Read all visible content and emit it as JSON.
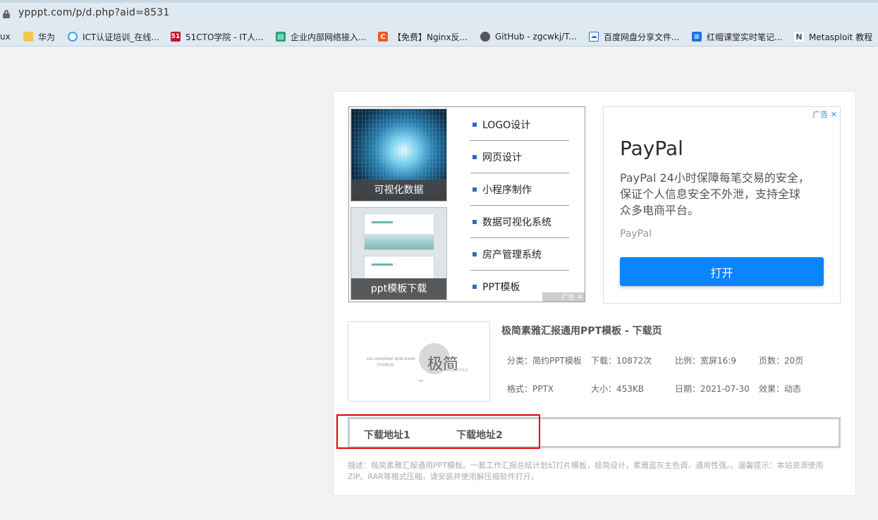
{
  "browser": {
    "url": "ypppt.com/p/d.php?aid=8531",
    "bookmarks": [
      {
        "label": "ux",
        "icon": "none"
      },
      {
        "label": "华为",
        "icon": "folder-icon"
      },
      {
        "label": "ICT认证培训_在线...",
        "icon": "ict-icon"
      },
      {
        "label": "51CTO学院 - IT人...",
        "icon": "51cto-icon"
      },
      {
        "label": "企业内部网络接入...",
        "icon": "doc-icon"
      },
      {
        "label": "【免费】Nginx反...",
        "icon": "csdn-icon"
      },
      {
        "label": "GitHub - zgcwkj/T...",
        "icon": "github-icon"
      },
      {
        "label": "百度网盘分享文件...",
        "icon": "baidu-icon"
      },
      {
        "label": "红帽课堂实时笔记...",
        "icon": "note-icon"
      },
      {
        "label": "Metasploit 教程",
        "icon": "metasploit-icon"
      }
    ],
    "bookmark_icon_glyphs": {
      "51cto": "51",
      "doc": "▤",
      "csdn": "C",
      "baidu": "☁",
      "note": "≡",
      "metasploit": "N"
    }
  },
  "ad_left": {
    "thumb1_caption": "可视化数据",
    "thumb2_caption": "ppt模板下载",
    "items": [
      "LOGO设计",
      "网页设计",
      "小程序制作",
      "数据可视化系统",
      "房产管理系统",
      "PPT模板"
    ],
    "ad_label": "广告",
    "close": "✕"
  },
  "ad_right": {
    "tag": "广告",
    "close": "✕",
    "name": "PayPal",
    "description": "PayPal 24小时保障每笔交易的安全，保证个人信息安全不外泄，支持全球众多电商平台。",
    "source": "PayPal",
    "button": "打开"
  },
  "product": {
    "thumb_big": "极简",
    "thumb_small1": "2021 DEPARTMENT WORK REPORT",
    "thumb_small2": "工作总结汇报",
    "thumb_small3": "MAL STYLE",
    "title": "极简素雅汇报通用PPT模板 - 下载页",
    "meta": {
      "category": "分类：简约PPT模板",
      "downloads": "下载：10872次",
      "ratio": "比例：宽屏16:9",
      "pages": "页数：20页",
      "format": "格式：PPTX",
      "size": "大小：453KB",
      "date": "日期：2021-07-30",
      "effect": "效果：动态"
    }
  },
  "download": {
    "link1": "下载地址1",
    "link2": "下载地址2"
  },
  "description": "描述：极简素雅汇报通用PPT模板。一套工作汇报总结计划幻灯片模板，极简设计，素雅蓝灰主色调，通用性强。。温馨提示：本站资源使用ZIP、RAR等格式压缩，请安装并使用解压缩软件打开。",
  "colors": {
    "highlight_box": "#e00000",
    "paypal_button": "#0a84ff",
    "list_bullet": "#2a6ebb"
  }
}
